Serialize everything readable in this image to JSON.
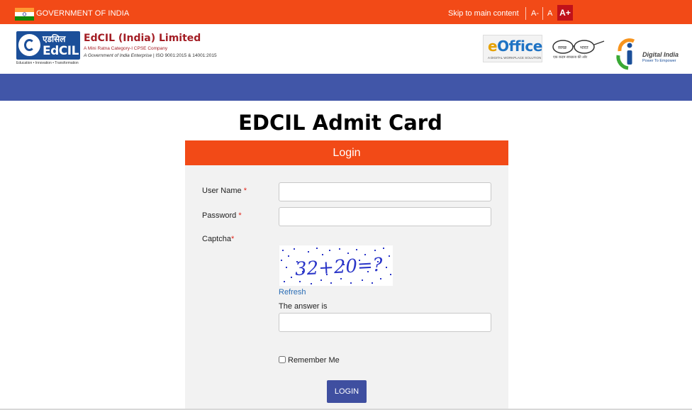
{
  "gov_bar": {
    "government_label": "GOVERNMENT OF INDIA",
    "skip_link": "Skip to main content",
    "font_decrease": "A-",
    "font_normal": "A",
    "font_increase": "A+",
    "bg_color": "#f24a17"
  },
  "header": {
    "logo_hindi": "एडसिल",
    "logo_text": "EdCIL",
    "logo_tagline": "Education • Innovation • Transformation",
    "org_name": "EdCIL (India) Limited",
    "org_subtitle": "A Mini Ratna Category-I CPSE Company",
    "org_enterprise": "A Government of India Enterprise",
    "org_iso": "| ISO 9001:2015 & 14001:2015",
    "eoffice_e": "e",
    "eoffice_rest": "Office",
    "eoffice_tagline": "A DIGITAL WORKPLACE SOLUTION",
    "swachh_caption": "एक कदम स्वच्छता की ओर",
    "digital_india_title": "Digital India",
    "digital_india_sub": "Power To Empower"
  },
  "navbar": {
    "color": "#4156a8"
  },
  "page": {
    "title": "EDCIL Admit Card"
  },
  "login": {
    "header": "Login",
    "username_label": "User Name",
    "password_label": "Password",
    "captcha_label": "Captcha",
    "required_mark": "*",
    "captcha_text": "32+20=?",
    "refresh_label": "Refresh",
    "answer_label": "The answer is",
    "remember_label": "Remember Me",
    "button_label": "LOGIN",
    "username_value": "",
    "password_value": "",
    "answer_value": ""
  }
}
